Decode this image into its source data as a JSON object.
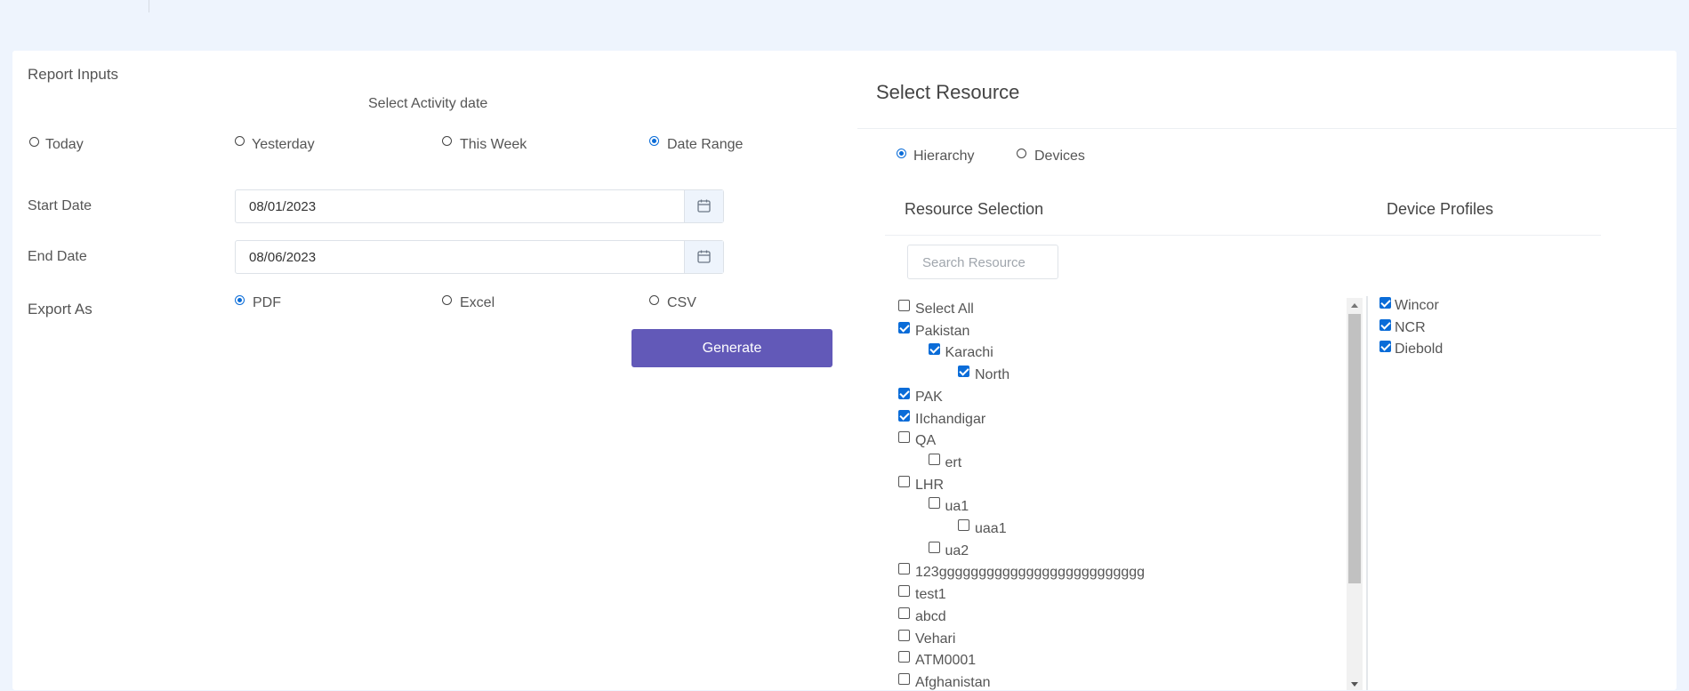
{
  "report_inputs": {
    "title": "Report Inputs",
    "activity_heading": "Select Activity date",
    "date_options": [
      "Today",
      "Yesterday",
      "This Week",
      "Date Range"
    ],
    "selected_date_option": "Date Range",
    "start_date_label": "Start Date",
    "start_date_value": "08/01/2023",
    "end_date_label": "End Date",
    "end_date_value": "08/06/2023",
    "export_label": "Export As",
    "export_options": [
      "PDF",
      "Excel",
      "CSV"
    ],
    "selected_export": "PDF",
    "generate_label": "Generate"
  },
  "resource": {
    "title": "Select Resource",
    "mode_options": [
      "Hierarchy",
      "Devices"
    ],
    "selected_mode": "Hierarchy",
    "resource_selection_title": "Resource Selection",
    "device_profiles_title": "Device Profiles",
    "search_placeholder": "Search Resource",
    "tree": [
      {
        "label": "Select All",
        "level": 0,
        "checked": false
      },
      {
        "label": "Pakistan",
        "level": 0,
        "checked": true
      },
      {
        "label": "Karachi",
        "level": 1,
        "checked": true
      },
      {
        "label": "North",
        "level": 2,
        "checked": true
      },
      {
        "label": "PAK",
        "level": 0,
        "checked": true
      },
      {
        "label": "IIchandigar",
        "level": 0,
        "checked": true
      },
      {
        "label": "QA",
        "level": 0,
        "checked": false
      },
      {
        "label": "ert",
        "level": 1,
        "checked": false
      },
      {
        "label": "LHR",
        "level": 0,
        "checked": false
      },
      {
        "label": "ua1",
        "level": 1,
        "checked": false
      },
      {
        "label": "uaa1",
        "level": 2,
        "checked": false
      },
      {
        "label": "ua2",
        "level": 1,
        "checked": false
      },
      {
        "label": "123gggggggggggggggggggggggggg",
        "level": 0,
        "checked": false
      },
      {
        "label": "test1",
        "level": 0,
        "checked": false
      },
      {
        "label": "abcd",
        "level": 0,
        "checked": false
      },
      {
        "label": "Vehari",
        "level": 0,
        "checked": false
      },
      {
        "label": "ATM0001",
        "level": 0,
        "checked": false
      },
      {
        "label": "Afghanistan",
        "level": 0,
        "checked": false
      }
    ],
    "device_profiles": [
      {
        "label": "Wincor",
        "checked": true
      },
      {
        "label": "NCR",
        "checked": true
      },
      {
        "label": "Diebold",
        "checked": true
      }
    ]
  }
}
